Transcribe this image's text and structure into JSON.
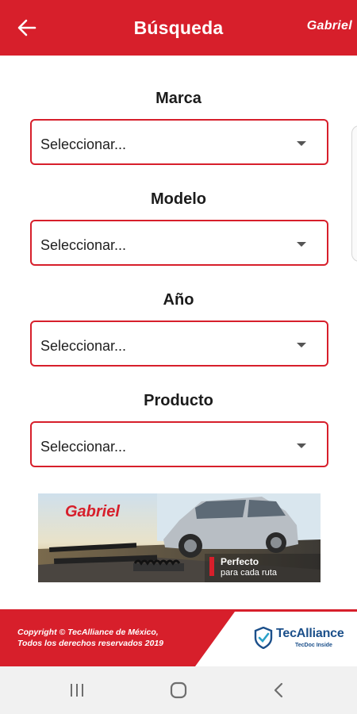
{
  "header": {
    "title": "Búsqueda",
    "brand_logo": "Gabriel",
    "back_icon": "arrow-left-icon",
    "color": "#d71f2b"
  },
  "form": {
    "fields": [
      {
        "label": "Marca",
        "value": "Seleccionar..."
      },
      {
        "label": "Modelo",
        "value": "Seleccionar..."
      },
      {
        "label": "Año",
        "value": "Seleccionar..."
      },
      {
        "label": "Producto",
        "value": "Seleccionar..."
      }
    ],
    "caret_icon": "caret-down-icon",
    "accent": "#d71f2b"
  },
  "banner": {
    "brand": "Gabriel",
    "tagline_main": "Perfecto",
    "tagline_sub": "para cada ruta"
  },
  "footer": {
    "copyright_line1": "Copyright © TecAlliance de México,",
    "copyright_line2": "Todos los derechos reservados 2019",
    "partner_name": "TecAlliance",
    "partner_sub": "TecDoc Inside",
    "partner_color": "#1b4f8a"
  },
  "navbar": {
    "recents_icon": "recents-icon",
    "home_icon": "home-icon",
    "back_icon": "back-chevron-icon"
  }
}
